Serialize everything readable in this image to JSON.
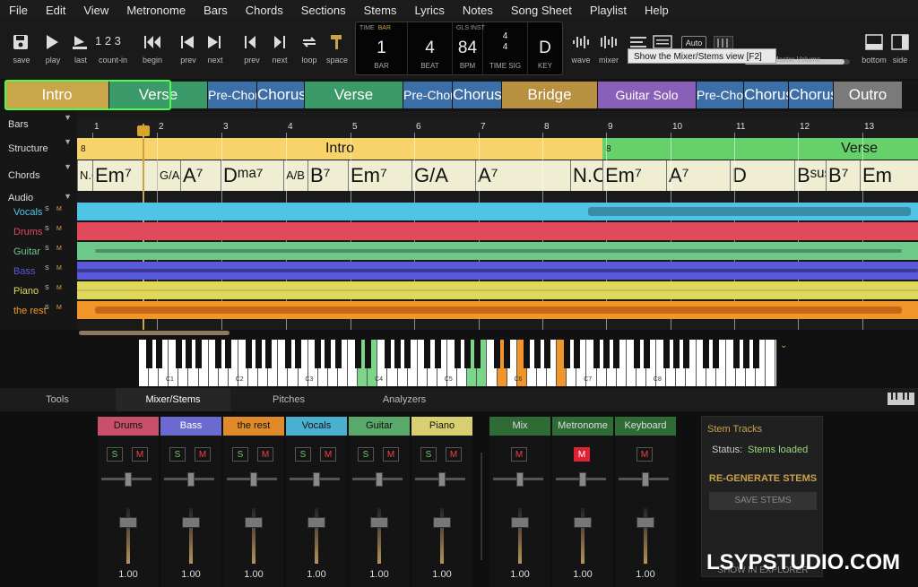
{
  "menu": [
    "File",
    "Edit",
    "View",
    "Metronome",
    "Bars",
    "Chords",
    "Sections",
    "Stems",
    "Lyrics",
    "Notes",
    "Song Sheet",
    "Playlist",
    "Help"
  ],
  "toolbar": {
    "save": "save",
    "play": "play",
    "last": "last",
    "countin": "count-in",
    "countin_glyph": "1 2 3",
    "begin": "begin",
    "prev1": "prev",
    "next1": "next",
    "prev2": "prev",
    "next2": "next",
    "loop": "loop",
    "space": "space",
    "wave": "wave",
    "mixer": "mixer",
    "auto": "Auto",
    "bottom": "bottom",
    "side": "side",
    "master_volume": "Master Volume",
    "master_level": 0.95
  },
  "display": {
    "time": "TIME",
    "bar_top": "BAR",
    "bar": "1",
    "bar_label": "BAR",
    "beat": "4",
    "beat_label": "BEAT",
    "gls": "GLS",
    "inst": "INST",
    "bpm": "84",
    "bpm_label": "BPM",
    "sig_top": "4",
    "sig_bottom": "4",
    "sig_label": "TIME SIG",
    "key": "D",
    "key_label": "KEY"
  },
  "tooltip": "Show the Mixer/Stems view [F2]",
  "sections_strip": [
    {
      "label": "Intro",
      "color": "#c9a64a"
    },
    {
      "label": "Verse",
      "color": "#3a9a68"
    },
    {
      "label": "Pre-Chorus",
      "color": "#3c6fa8"
    },
    {
      "label": "Chorus",
      "color": "#3c6fa8"
    },
    {
      "label": "Verse",
      "color": "#3a9a68"
    },
    {
      "label": "Pre-Chorus",
      "color": "#3c6fa8"
    },
    {
      "label": "Chorus",
      "color": "#3c6fa8"
    },
    {
      "label": "Bridge",
      "color": "#b89040"
    },
    {
      "label": "Guitar Solo",
      "color": "#8a5fb8"
    },
    {
      "label": "Pre-Chorus",
      "color": "#3c6fa8"
    },
    {
      "label": "Chorus",
      "color": "#3c6fa8"
    },
    {
      "label": "Chorus",
      "color": "#3c6fa8"
    },
    {
      "label": "Outro",
      "color": "#7a7a7a"
    }
  ],
  "lanes": {
    "bars": "Bars",
    "structure": "Structure",
    "chords": "Chords",
    "audio": "Audio"
  },
  "stems": [
    {
      "name": "Vocals",
      "color": "#4fc4e6"
    },
    {
      "name": "Drums",
      "color": "#e04a5a"
    },
    {
      "name": "Guitar",
      "color": "#6cc98a"
    },
    {
      "name": "Bass",
      "color": "#5a5ad8"
    },
    {
      "name": "Piano",
      "color": "#e0d85a"
    },
    {
      "name": "the rest",
      "color": "#f2962a"
    }
  ],
  "stem_s": "S",
  "stem_m": "M",
  "ruler": [
    "1",
    "2",
    "3",
    "4",
    "5",
    "6",
    "7",
    "8",
    "9",
    "10",
    "11",
    "12",
    "13"
  ],
  "structure": [
    {
      "label": "Intro",
      "num": "8",
      "color": "#f7d36a"
    },
    {
      "label": "Verse",
      "num": "8",
      "color": "#66d06a"
    }
  ],
  "chords": [
    "N.C.",
    "Em⁷",
    "G/A",
    "A⁷",
    "Dᵐᵃ⁷",
    "A/B",
    "B⁷",
    "Em⁷",
    "G/A",
    "A⁷",
    "N.C.",
    "Em⁷",
    "A⁷",
    "D",
    "Bˢᵘˢ⁴",
    "B⁷",
    "Em"
  ],
  "piano_labels": [
    "C1",
    "C2",
    "C3",
    "C4",
    "C5",
    "C6",
    "C7",
    "C8"
  ],
  "tabs": [
    "Tools",
    "Mixer/Stems",
    "Pitches",
    "Analyzers"
  ],
  "mixer": {
    "strips": [
      {
        "name": "Drums",
        "color": "#c8506a",
        "value": "1.00"
      },
      {
        "name": "Bass",
        "color": "#6a6ad0",
        "value": "1.00"
      },
      {
        "name": "the rest",
        "color": "#e08a2a",
        "value": "1.00"
      },
      {
        "name": "Vocals",
        "color": "#4ab0d0",
        "value": "1.00"
      },
      {
        "name": "Guitar",
        "color": "#5aa86a",
        "value": "1.00"
      },
      {
        "name": "Piano",
        "color": "#d8d070",
        "value": "1.00"
      },
      {
        "name": "Mix",
        "color": "#2e6b35",
        "value": "1.00"
      },
      {
        "name": "Metronome",
        "color": "#2e6b35",
        "value": "1.00"
      },
      {
        "name": "Keyboard",
        "color": "#2e6b35",
        "value": "1.00"
      }
    ],
    "s": "S",
    "m": "M"
  },
  "stem_panel": {
    "title": "Stem Tracks",
    "status_label": "Status:",
    "status_value": "Stems loaded",
    "regen": "RE-GENERATE STEMS",
    "save": "SAVE STEMS",
    "explorer": "SHOW IN EXPLORER"
  },
  "watermark": "LSYPSTUDIO.COM"
}
